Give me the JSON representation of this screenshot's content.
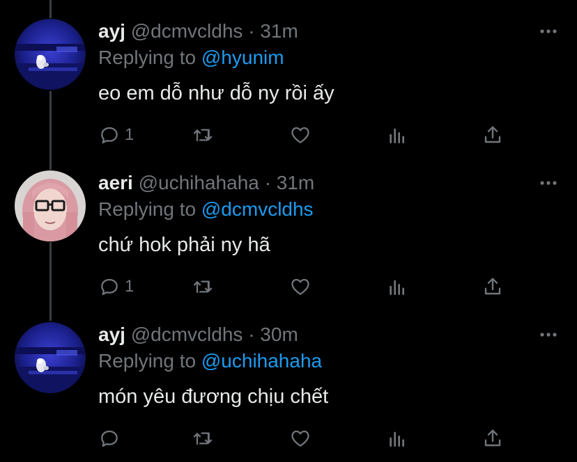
{
  "colors": {
    "background": "#000000",
    "text": "#e7e9ea",
    "muted": "#71767b",
    "link": "#1d9bf0",
    "thread": "#3a3d40"
  },
  "icons": [
    "reply-icon",
    "retweet-icon",
    "like-icon",
    "analytics-icon",
    "share-icon",
    "more-icon"
  ],
  "tweets": [
    {
      "name": "ayj",
      "handle": "@dcmvcldhs",
      "separator": "·",
      "time": "31m",
      "replying_prefix": "Replying to",
      "replying_to": "@hyunim",
      "text": "eo em dỗ như dỗ ny rồi ấy",
      "reply_count": "1",
      "avatar": "blue-night-avatar"
    },
    {
      "name": "aeri",
      "handle": "@uchihahaha",
      "separator": "·",
      "time": "31m",
      "replying_prefix": "Replying to",
      "replying_to": "@dcmvcldhs",
      "text": "chứ hok phải ny hã",
      "reply_count": "1",
      "avatar": "pink-hair-avatar"
    },
    {
      "name": "ayj",
      "handle": "@dcmvcldhs",
      "separator": "·",
      "time": "30m",
      "replying_prefix": "Replying to",
      "replying_to": "@uchihahaha",
      "text": "món yêu đương chịu chết",
      "reply_count": "",
      "avatar": "blue-night-avatar"
    }
  ]
}
